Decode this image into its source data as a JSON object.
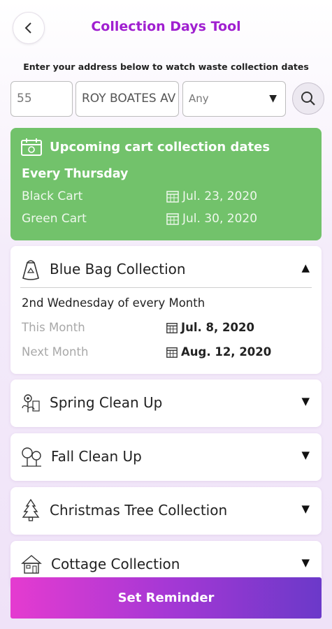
{
  "header": {
    "title": "Collection Days Tool",
    "back_icon": "chevron-left-icon"
  },
  "instruction": "Enter your address below to watch waste collection dates",
  "address": {
    "number_value": "55",
    "street_value": "ROY BOATES AV",
    "suffix_selected": "Any"
  },
  "upcoming": {
    "heading": "Upcoming cart collection dates",
    "frequency": "Every Thursday",
    "carts": [
      {
        "label": "Black Cart",
        "date": "Jul. 23, 2020"
      },
      {
        "label": "Green Cart",
        "date": "Jul. 30, 2020"
      }
    ],
    "color": "#72c26b"
  },
  "collections": [
    {
      "name": "Blue Bag Collection",
      "icon": "bag-icon",
      "expanded": true,
      "schedule": "2nd Wednesday of every Month",
      "rows": [
        {
          "label": "This Month",
          "date": "Jul. 8, 2020"
        },
        {
          "label": "Next Month",
          "date": "Aug. 12, 2020"
        }
      ]
    },
    {
      "name": "Spring Clean Up",
      "icon": "spring-icon",
      "expanded": false
    },
    {
      "name": "Fall Clean Up",
      "icon": "fall-trees-icon",
      "expanded": false
    },
    {
      "name": "Christmas Tree Collection",
      "icon": "christmas-tree-icon",
      "expanded": false
    },
    {
      "name": "Cottage Collection",
      "icon": "cottage-icon",
      "expanded": false
    }
  ],
  "toggle_glyphs": {
    "open": "▲",
    "closed": "▼"
  },
  "select_arrow": "▼",
  "reminder_button": "Set Reminder",
  "accent_color": "#a01fd0"
}
